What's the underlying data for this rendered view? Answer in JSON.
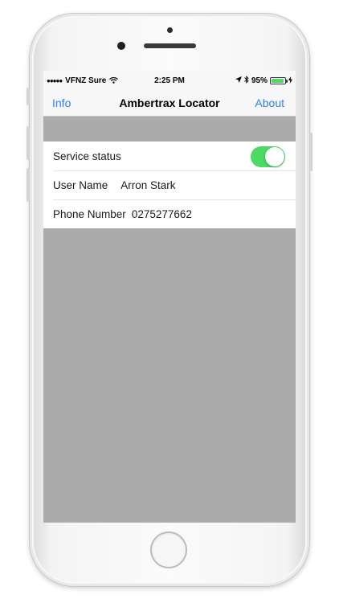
{
  "status_bar": {
    "carrier": "VFNZ Sure",
    "signal_dots": "●●●●●",
    "time": "2:25 PM",
    "battery_percent": "95%",
    "battery_level": 0.95
  },
  "nav_bar": {
    "left_button": "Info",
    "title": "Ambertrax Locator",
    "right_button": "About"
  },
  "settings": {
    "service_status": {
      "label": "Service status",
      "enabled": true
    },
    "user_name": {
      "label": "User Name",
      "value": "Arron Stark"
    },
    "phone_number": {
      "label": "Phone Number",
      "value": "0275277662"
    }
  },
  "colors": {
    "tint": "#2f7ef6",
    "toggle_on": "#4cd964",
    "screen_background": "#ababab"
  },
  "icons": [
    "wifi-icon",
    "location-arrow-icon",
    "bluetooth-icon",
    "battery-icon",
    "charging-icon"
  ]
}
